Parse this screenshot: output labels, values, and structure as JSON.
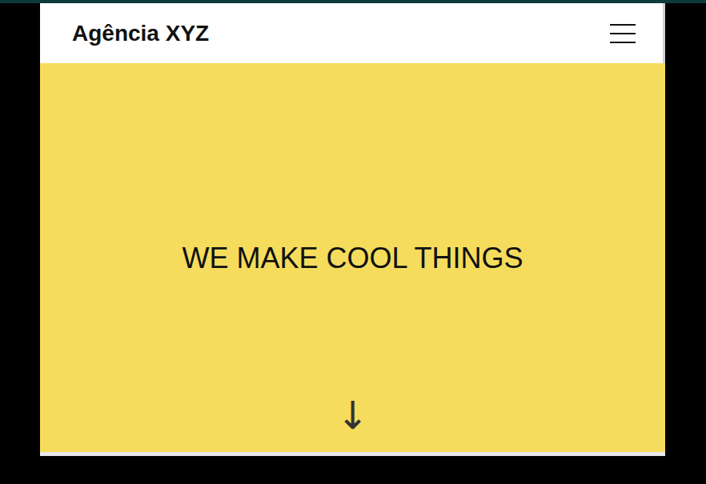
{
  "header": {
    "title": "Agência XYZ"
  },
  "hero": {
    "headline": "WE MAKE COOL THINGS",
    "scroll_hint": "↓"
  }
}
